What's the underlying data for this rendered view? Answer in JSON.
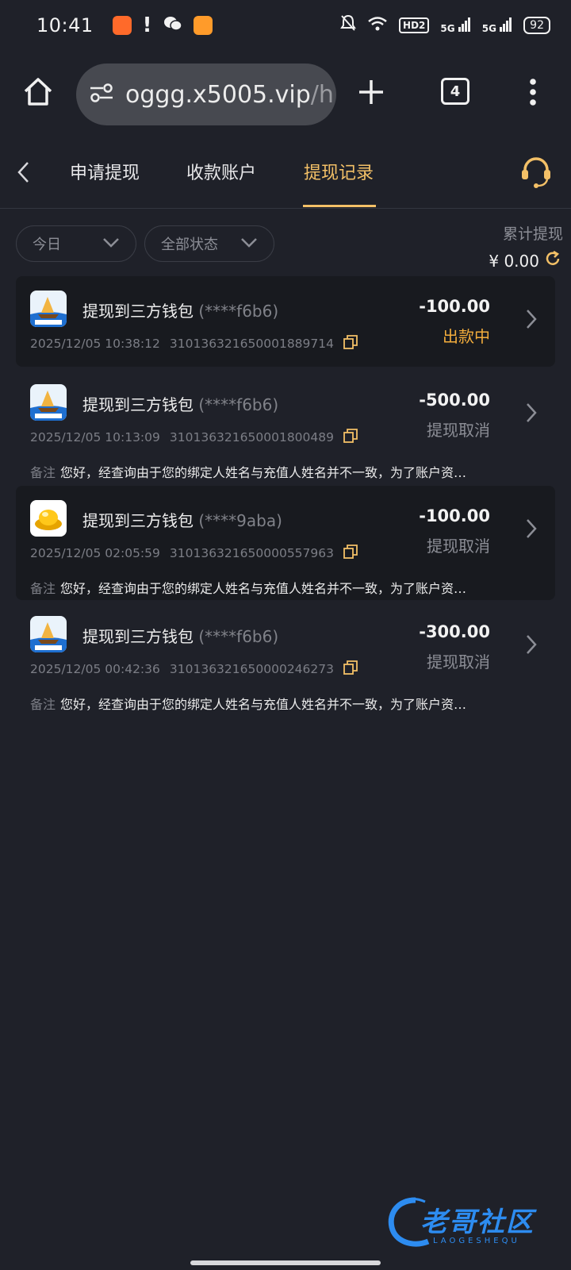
{
  "status_bar": {
    "time": "10:41",
    "hd_label": "HD2",
    "net1": "5G",
    "net2": "5G",
    "battery": "92"
  },
  "browser": {
    "url_main": "oggg.x5005.vip",
    "url_tail": "/h",
    "tab_count": "4"
  },
  "nav": {
    "tabs": [
      {
        "label": "申请提现"
      },
      {
        "label": "收款账户"
      },
      {
        "label": "提现记录"
      }
    ],
    "active_tab": "提现记录"
  },
  "filters": {
    "date": "今日",
    "status": "全部状态"
  },
  "summary": {
    "label": "累计提现",
    "value": "¥ 0.00"
  },
  "remark_label": "备注",
  "records": [
    {
      "title": "提现到三方钱包",
      "account": "(****f6b6)",
      "datetime": "2025/12/05 10:38:12",
      "order_no": "310136321650001889714",
      "amount": "-100.00",
      "status": "出款中",
      "remark": ""
    },
    {
      "title": "提现到三方钱包",
      "account": "(****f6b6)",
      "datetime": "2025/12/05 10:13:09",
      "order_no": "310136321650001800489",
      "amount": "-500.00",
      "status": "提现取消",
      "remark": "您好，经查询由于您的绑定人姓名与充值人姓名并不一致，为了账户资…"
    },
    {
      "title": "提现到三方钱包",
      "account": "(****9aba)",
      "datetime": "2025/12/05 02:05:59",
      "order_no": "310136321650000557963",
      "amount": "-100.00",
      "status": "提现取消",
      "remark": "您好，经查询由于您的绑定人姓名与充值人姓名并不一致，为了账户资…"
    },
    {
      "title": "提现到三方钱包",
      "account": "(****f6b6)",
      "datetime": "2025/12/05 00:42:36",
      "order_no": "310136321650000246273",
      "amount": "-300.00",
      "status": "提现取消",
      "remark": "您好，经查询由于您的绑定人姓名与充值人姓名并不一致，为了账户资…"
    }
  ],
  "watermark": {
    "text": "老哥社区",
    "sub": "LAOGESHEQU"
  },
  "colors": {
    "background": "#1f2129",
    "accent": "#f3c067",
    "pending": "#f3ad3c"
  }
}
